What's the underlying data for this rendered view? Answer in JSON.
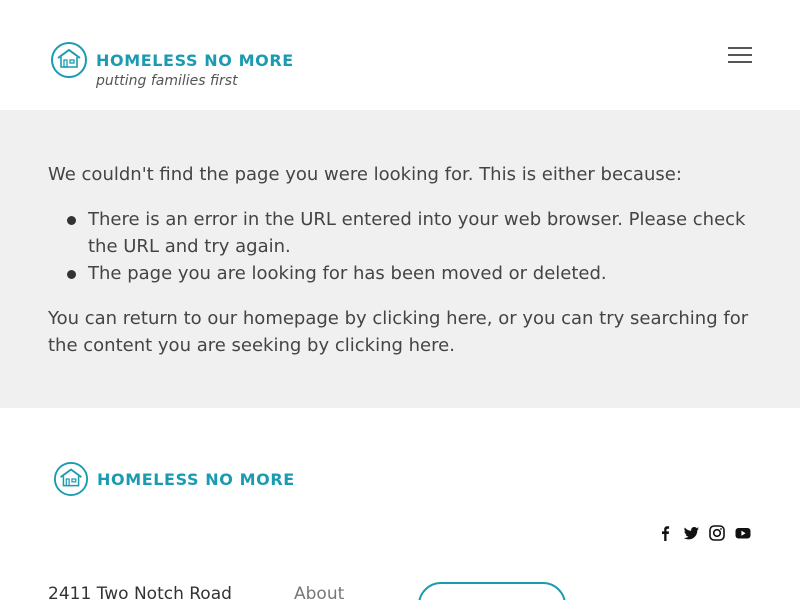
{
  "header": {
    "logo": {
      "name": "HOMELESS NO MORE",
      "tagline": "putting families first",
      "icon": "house-logo-icon",
      "brand_color": "#1b9bb0"
    },
    "menu_icon": "hamburger-menu-icon"
  },
  "main": {
    "background": "#f0f0f0",
    "intro": "We couldn't find the page you were looking for. This is either because:",
    "reasons": [
      "There is an error in the URL entered into your web browser. Please check the URL and try again.",
      "The page you are looking for has been moved or deleted."
    ],
    "outro": {
      "part1": "You can return to our homepage by ",
      "link1": "clicking here",
      "part2": ", or you can try searching for the content you are seeking by ",
      "link2": "clicking here",
      "part3": "."
    }
  },
  "footer": {
    "logo_name": "HOMELESS NO MORE",
    "social_icons": [
      "facebook-icon",
      "twitter-icon",
      "instagram-icon",
      "youtube-icon"
    ],
    "address_line1": "2411 Two Notch Road",
    "nav_item": "About"
  }
}
